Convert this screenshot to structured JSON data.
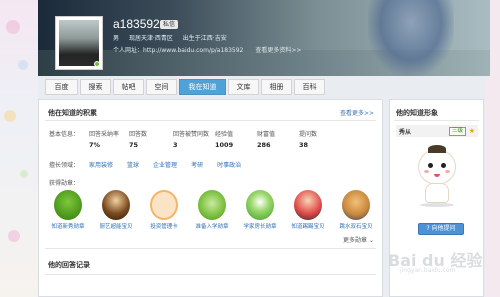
{
  "profile": {
    "username": "a183592",
    "badge": "私信",
    "gender": "男",
    "location": "现居天津·西青区",
    "birthplace": "出生于江西·吉安",
    "homepage": "个人网址：http://www.baidu.com/p/a183592",
    "more_info": "查看更多资料>>"
  },
  "tabs": [
    {
      "label": "百度"
    },
    {
      "label": "搜索"
    },
    {
      "label": "帖吧"
    },
    {
      "label": "空间"
    },
    {
      "label": "我在知道"
    },
    {
      "label": "文库"
    },
    {
      "label": "相册"
    },
    {
      "label": "百科"
    }
  ],
  "zhidao": {
    "title": "他在知道的积累",
    "more": "查看更多>>",
    "stat_labels": [
      "基本信息：",
      "回答采纳率",
      "回答数",
      "回答被赞同数",
      "经验值",
      "财富值",
      "提问数"
    ],
    "stat_values": [
      "",
      "7%",
      "75",
      "3",
      "1009",
      "286",
      "38"
    ],
    "fields_label": "擅长领域：",
    "fields": [
      "家用装修",
      "篮球",
      "企业管理",
      "考研",
      "时事政治"
    ],
    "medals_label": "获得勋章：",
    "medals": [
      {
        "name": "知道新秀勋章"
      },
      {
        "name": "厨艺超能宝贝"
      },
      {
        "name": "投资管理卡"
      },
      {
        "name": "准备入学勋章"
      },
      {
        "name": "学家房长勋章"
      },
      {
        "name": "知道踢踢宝贝"
      },
      {
        "name": "跳水双石宝贝"
      }
    ],
    "more_medals": "更多勋章",
    "answers_title": "他的回答记录"
  },
  "side": {
    "title": "他的知道形象",
    "rank_label": "秀从",
    "rank_badge": "三级",
    "ask_button": "向他提问"
  },
  "watermark": {
    "text": "Bai du 经验",
    "sub": "jingyan.baidu.com"
  }
}
